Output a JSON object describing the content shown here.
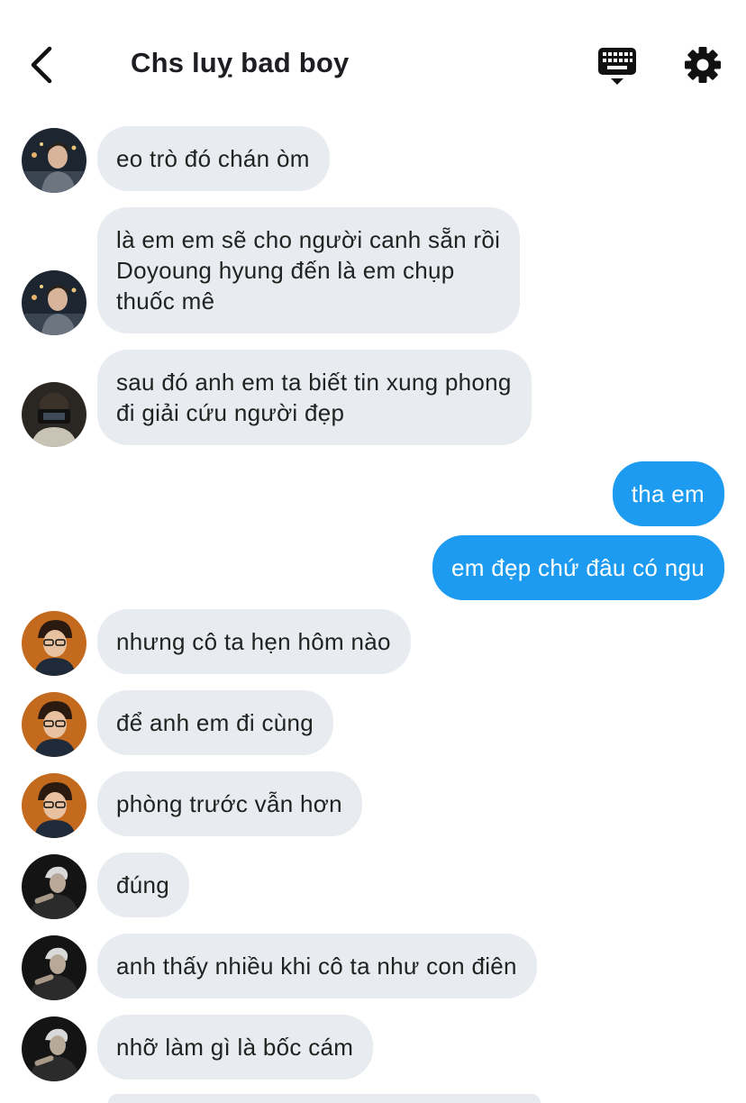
{
  "header": {
    "title": "Chs luỵ bad boy",
    "back_icon": "chevron-left-icon",
    "keyboard_icon": "keyboard-icon",
    "settings_icon": "gear-icon"
  },
  "colors": {
    "incoming_bubble": "#e8ebef",
    "outgoing_bubble": "#1d9bf0",
    "text": "#1c1e21"
  },
  "messages": [
    {
      "direction": "in",
      "text": "eo trò đó chán òm",
      "avatar": "user-a"
    },
    {
      "direction": "in",
      "text": "là em em sẽ cho người canh sẵn rồi\nDoyoung hyung đến là em chụp\nthuốc mê",
      "avatar": "user-a"
    },
    {
      "direction": "in",
      "text": "sau đó anh em ta biết tin xung phong\nđi giải cứu người đẹp",
      "avatar": "user-b"
    },
    {
      "direction": "out",
      "text": "tha em"
    },
    {
      "direction": "out",
      "text": "em đẹp chứ đâu có ngu"
    },
    {
      "direction": "in",
      "text": "nhưng cô ta hẹn hôm nào",
      "avatar": "user-c"
    },
    {
      "direction": "in",
      "text": "để anh em đi cùng",
      "avatar": "user-c"
    },
    {
      "direction": "in",
      "text": "phòng trước vẫn hơn",
      "avatar": "user-c"
    },
    {
      "direction": "in",
      "text": "đúng",
      "avatar": "user-d"
    },
    {
      "direction": "in",
      "text": "anh thấy nhiều khi cô ta như con điên",
      "avatar": "user-d"
    },
    {
      "direction": "in",
      "text": "nhỡ làm gì là bốc cám",
      "avatar": "user-d"
    }
  ]
}
